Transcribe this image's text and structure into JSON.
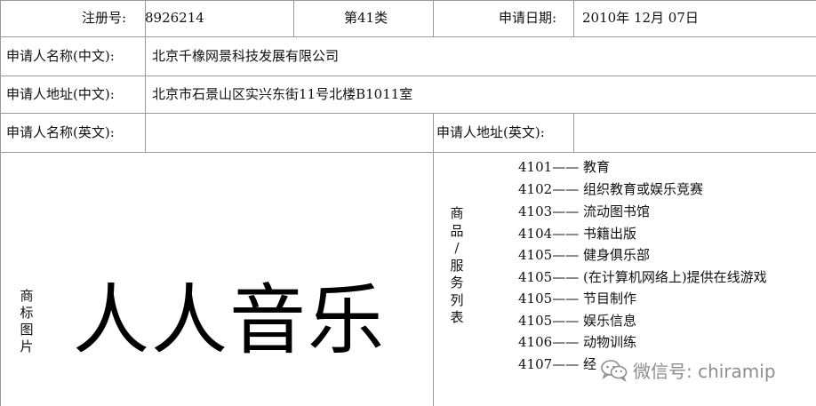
{
  "header": {
    "reg_no_label": "注册号:",
    "reg_no_value": "8926214",
    "class_label": "第41类",
    "date_label": "申请日期:",
    "date_value": "2010年 12月 07日"
  },
  "applicant": {
    "name_cn_label": "申请人名称(中文):",
    "name_cn_value": "北京千橡网景科技发展有限公司",
    "addr_cn_label": "申请人地址(中文):",
    "addr_cn_value": "北京市石景山区实兴东街11号北楼B1011室",
    "name_en_label": "申请人名称(英文):",
    "name_en_value": "",
    "addr_en_label": "申请人地址(英文):",
    "addr_en_value": ""
  },
  "trademark": {
    "image_label_chars": [
      "商",
      "标",
      "图",
      "片"
    ],
    "mark_text": "人人音乐"
  },
  "services": {
    "label_chars": [
      "商",
      "品",
      "/",
      "服",
      "务",
      "列",
      "表"
    ],
    "items": [
      {
        "code": "4101",
        "sep": "——",
        "name": "教育"
      },
      {
        "code": "4102",
        "sep": "——",
        "name": "组织教育或娱乐竞赛"
      },
      {
        "code": "4103",
        "sep": "——",
        "name": "流动图书馆"
      },
      {
        "code": "4104",
        "sep": "——",
        "name": "书籍出版"
      },
      {
        "code": "4105",
        "sep": "——",
        "name": "健身俱乐部"
      },
      {
        "code": "4105",
        "sep": "——",
        "name": "(在计算机网络上)提供在线游戏"
      },
      {
        "code": "4105",
        "sep": "——",
        "name": "节目制作"
      },
      {
        "code": "4105",
        "sep": "——",
        "name": "娱乐信息"
      },
      {
        "code": "4106",
        "sep": "——",
        "name": "动物训练"
      },
      {
        "code": "4107",
        "sep": "——",
        "name": "经"
      }
    ]
  },
  "watermark": {
    "icon": "wechat-icon",
    "text": "微信号: chiramip",
    "color": "#8d8d8d"
  }
}
